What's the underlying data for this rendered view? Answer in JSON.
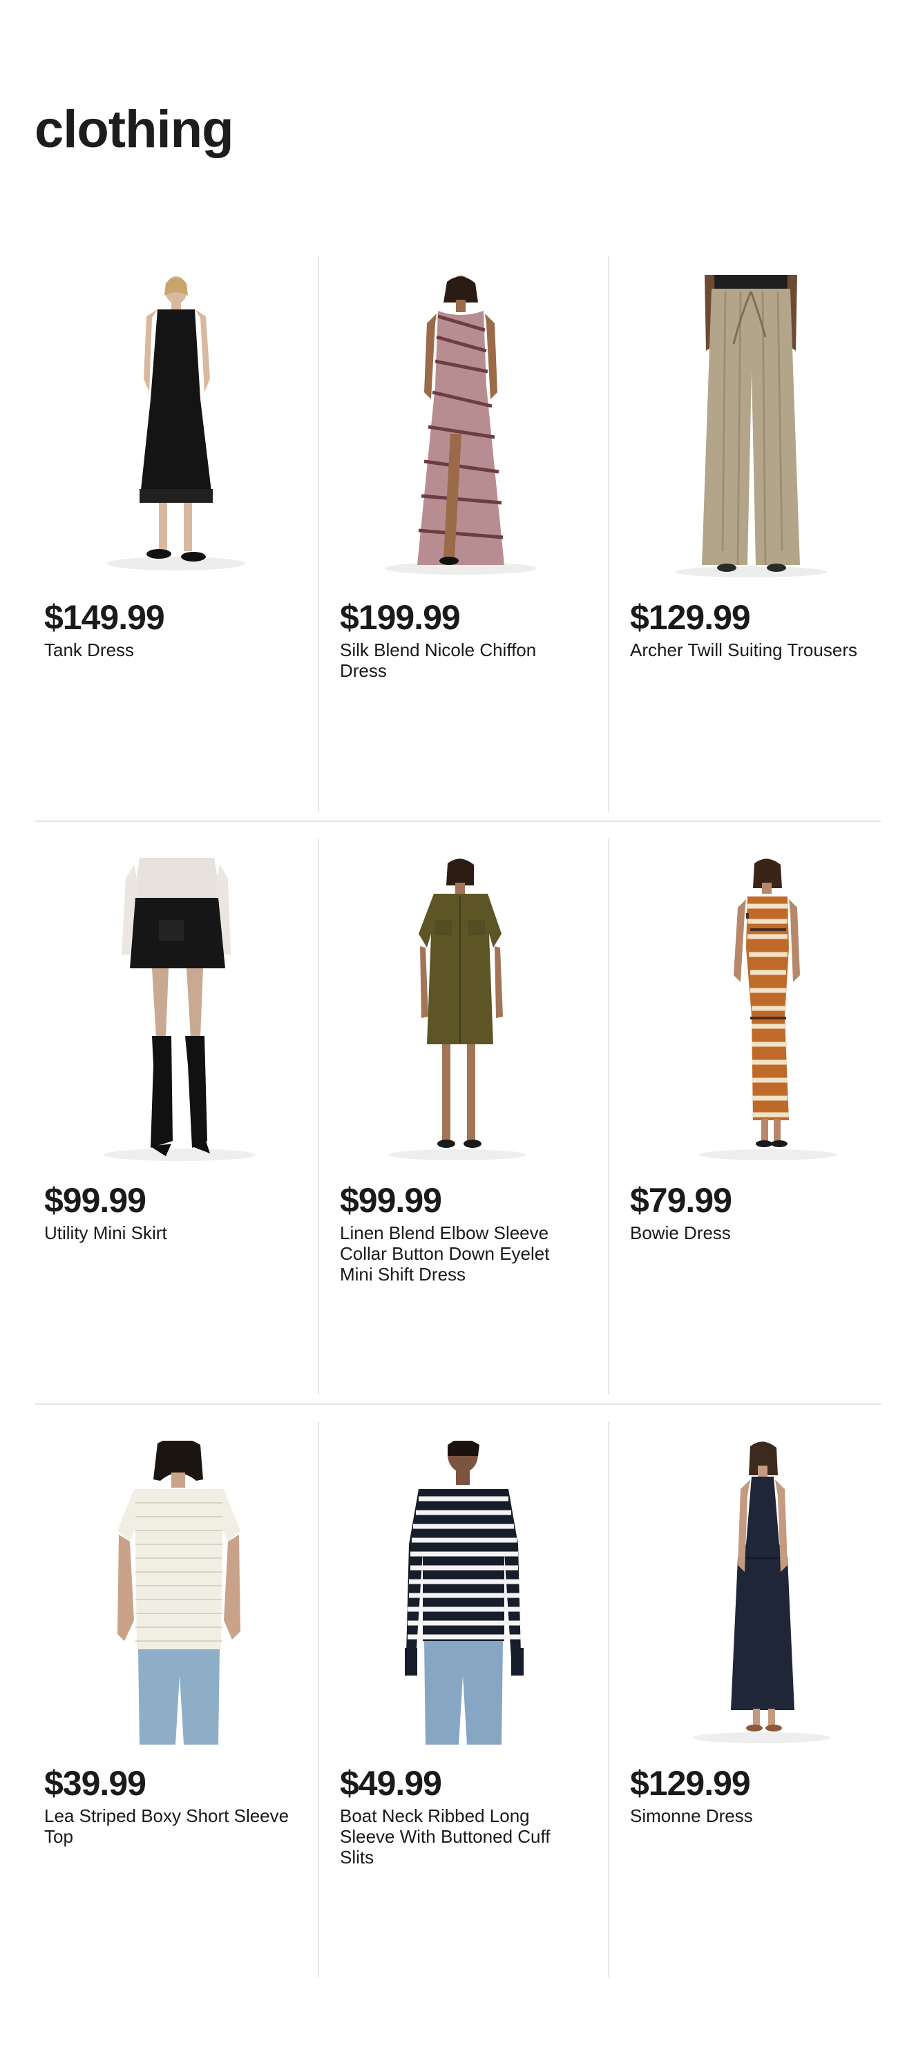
{
  "page": {
    "title": "clothing"
  },
  "products": [
    {
      "price": "$149.99",
      "name": "Tank Dress",
      "image": "black-tank-dress-image"
    },
    {
      "price": "$199.99",
      "name": "Silk Blend Nicole Chiffon Dress",
      "image": "zebra-chiffon-gown-image"
    },
    {
      "price": "$129.99",
      "name": "Archer Twill Suiting Trousers",
      "image": "khaki-wide-trousers-image"
    },
    {
      "price": "$99.99",
      "name": "Utility Mini Skirt",
      "image": "black-utility-skirt-image"
    },
    {
      "price": "$99.99",
      "name": "Linen Blend Elbow Sleeve Collar Button Down Eyelet Mini Shift Dress",
      "image": "olive-shirt-dress-image"
    },
    {
      "price": "$79.99",
      "name": "Bowie Dress",
      "image": "striped-knit-dress-image"
    },
    {
      "price": "$39.99",
      "name": "Lea Striped Boxy Short Sleeve Top",
      "image": "cream-striped-tee-image"
    },
    {
      "price": "$49.99",
      "name": "Boat Neck Ribbed Long Sleeve With Buttoned Cuff Slits",
      "image": "navy-striped-sweater-image"
    },
    {
      "price": "$129.99",
      "name": "Simonne Dress",
      "image": "navy-halter-dress-image"
    }
  ],
  "colors": {
    "text": "#1a1a1a",
    "divider": "#e6e6e6",
    "background": "#ffffff"
  }
}
